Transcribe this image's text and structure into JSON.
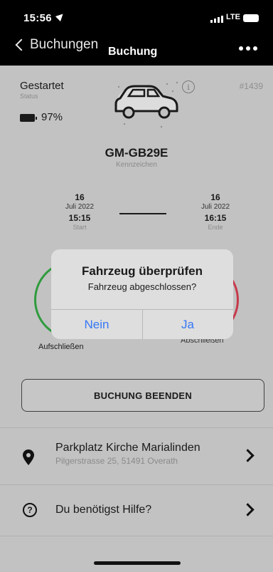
{
  "status_bar": {
    "time": "15:56",
    "network": "LTE"
  },
  "nav": {
    "back_label": "Buchungen",
    "title": "Buchung"
  },
  "booking": {
    "status": "Gestartet",
    "status_caption": "Status",
    "battery": "97%",
    "number": "#1439",
    "plate": "GM-GB29E",
    "plate_caption": "Kennzeichen",
    "start": {
      "day": "16",
      "month": "Juli 2022",
      "time": "15:15",
      "caption": "Start"
    },
    "end": {
      "day": "16",
      "month": "Juli 2022",
      "time": "16:15",
      "caption": "Ende"
    }
  },
  "actions": {
    "unlock_label": "Aufschließen",
    "lock_label": "Abschließen",
    "end_booking": "BUCHUNG BEENDEN"
  },
  "location": {
    "name": "Parkplatz Kirche Marialinden",
    "address": "Pilgerstrasse 25, 51491 Overath"
  },
  "help": {
    "label": "Du benötigst Hilfe?"
  },
  "dialog": {
    "title": "Fahrzeug überprüfen",
    "message": "Fahrzeug abgeschlossen?",
    "cancel": "Nein",
    "confirm": "Ja"
  },
  "colors": {
    "accent": "#3478f6",
    "unlock": "#2f9b3d",
    "lock": "#c7394b"
  },
  "icons": {
    "car": "car-icon",
    "info": "info-icon",
    "pin": "map-pin-icon",
    "help": "help-icon",
    "battery": "battery-icon"
  }
}
